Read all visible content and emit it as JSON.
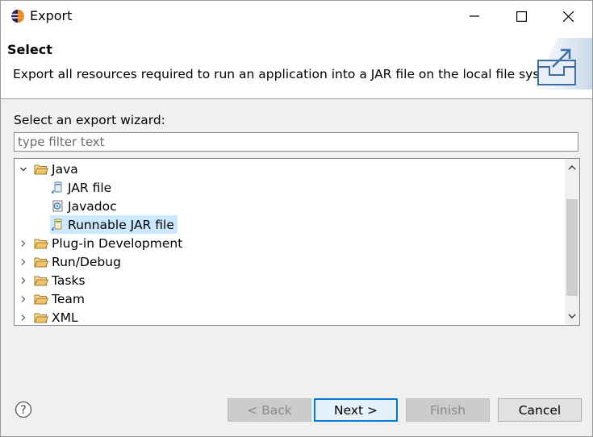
{
  "window": {
    "title": "Export"
  },
  "banner": {
    "title": "Select",
    "description": "Export all resources required to run an application into a JAR file on the local file system."
  },
  "wizard": {
    "prompt": "Select an export wizard:",
    "filter_placeholder": "type filter text",
    "filter_value": ""
  },
  "tree": {
    "java": {
      "label": "Java",
      "expanded": true,
      "children": [
        {
          "label": "JAR file",
          "icon": "jar-file-icon"
        },
        {
          "label": "Javadoc",
          "icon": "javadoc-icon"
        },
        {
          "label": "Runnable JAR file",
          "icon": "runnable-jar-icon",
          "selected": true
        }
      ]
    },
    "others": [
      {
        "label": "Plug-in Development"
      },
      {
        "label": "Run/Debug"
      },
      {
        "label": "Tasks"
      },
      {
        "label": "Team"
      },
      {
        "label": "XML"
      }
    ]
  },
  "buttons": {
    "back": "< Back",
    "next": "Next >",
    "finish": "Finish",
    "cancel": "Cancel"
  },
  "colors": {
    "selection": "#cce8ff",
    "default_button_border": "#0078d7",
    "folder": "#f0c36a"
  }
}
